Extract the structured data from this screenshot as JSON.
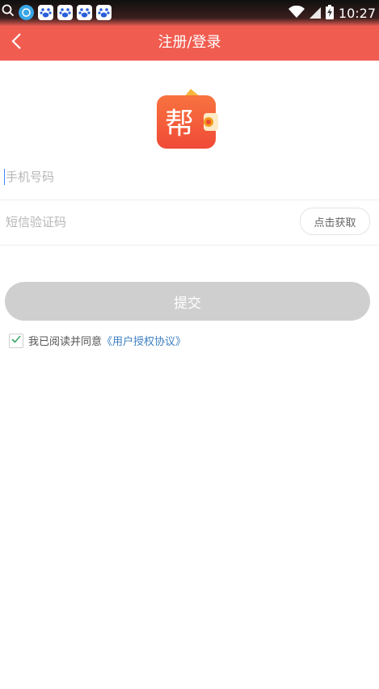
{
  "status_bar": {
    "time": "10:27",
    "icons": [
      "search-icon",
      "app-notification-icon",
      "baidu-icon",
      "baidu-icon",
      "baidu-icon",
      "baidu-icon",
      "wifi-icon",
      "signal-icon",
      "battery-charging-icon"
    ]
  },
  "header": {
    "title": "注册/登录",
    "back_icon": "chevron-left-icon"
  },
  "logo": {
    "text": "帮",
    "color": "#f4643f"
  },
  "form": {
    "phone_placeholder": "手机号码",
    "code_placeholder": "短信验证码",
    "get_code_label": "点击获取",
    "submit_label": "提交"
  },
  "agreement": {
    "checked": true,
    "prefix": "我已阅读并同意",
    "link_text": "《用户授权协议》"
  },
  "colors": {
    "header": "#f15c50",
    "submit_disabled": "#cfcfcf",
    "link": "#3c7fc1"
  }
}
